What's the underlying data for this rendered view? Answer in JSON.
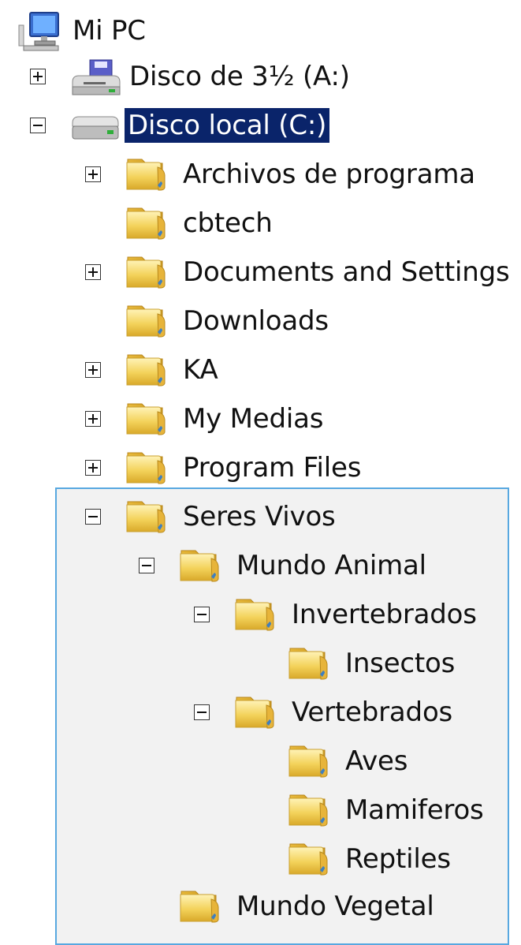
{
  "tree": {
    "root": {
      "label": "Mi PC",
      "icon": "computer-icon"
    },
    "drives": [
      {
        "label": "Disco de 3½ (A:)",
        "icon": "floppy-drive-icon",
        "state": "collapsed"
      },
      {
        "label": "Disco local (C:)",
        "icon": "hard-drive-icon",
        "state": "expanded",
        "selected": true
      }
    ],
    "folders": [
      {
        "label": "Archivos de programa",
        "state": "collapsed"
      },
      {
        "label": "cbtech",
        "state": "none"
      },
      {
        "label": "Documents and Settings",
        "state": "collapsed"
      },
      {
        "label": "Downloads",
        "state": "none"
      },
      {
        "label": "KA",
        "state": "collapsed"
      },
      {
        "label": "My Medias",
        "state": "collapsed"
      },
      {
        "label": "Program Files",
        "state": "collapsed"
      },
      {
        "label": "Seres Vivos",
        "state": "expanded"
      },
      {
        "label": "Mundo Animal",
        "state": "expanded"
      },
      {
        "label": "Invertebrados",
        "state": "expanded"
      },
      {
        "label": "Insectos",
        "state": "none"
      },
      {
        "label": "Vertebrados",
        "state": "expanded"
      },
      {
        "label": "Aves",
        "state": "none"
      },
      {
        "label": "Mamiferos",
        "state": "none"
      },
      {
        "label": "Reptiles",
        "state": "none"
      },
      {
        "label": "Mundo Vegetal",
        "state": "none"
      }
    ]
  },
  "colors": {
    "selection": "#0a246a",
    "highlight_border": "#58a8e0",
    "folder_fill": "#f3d25a"
  }
}
